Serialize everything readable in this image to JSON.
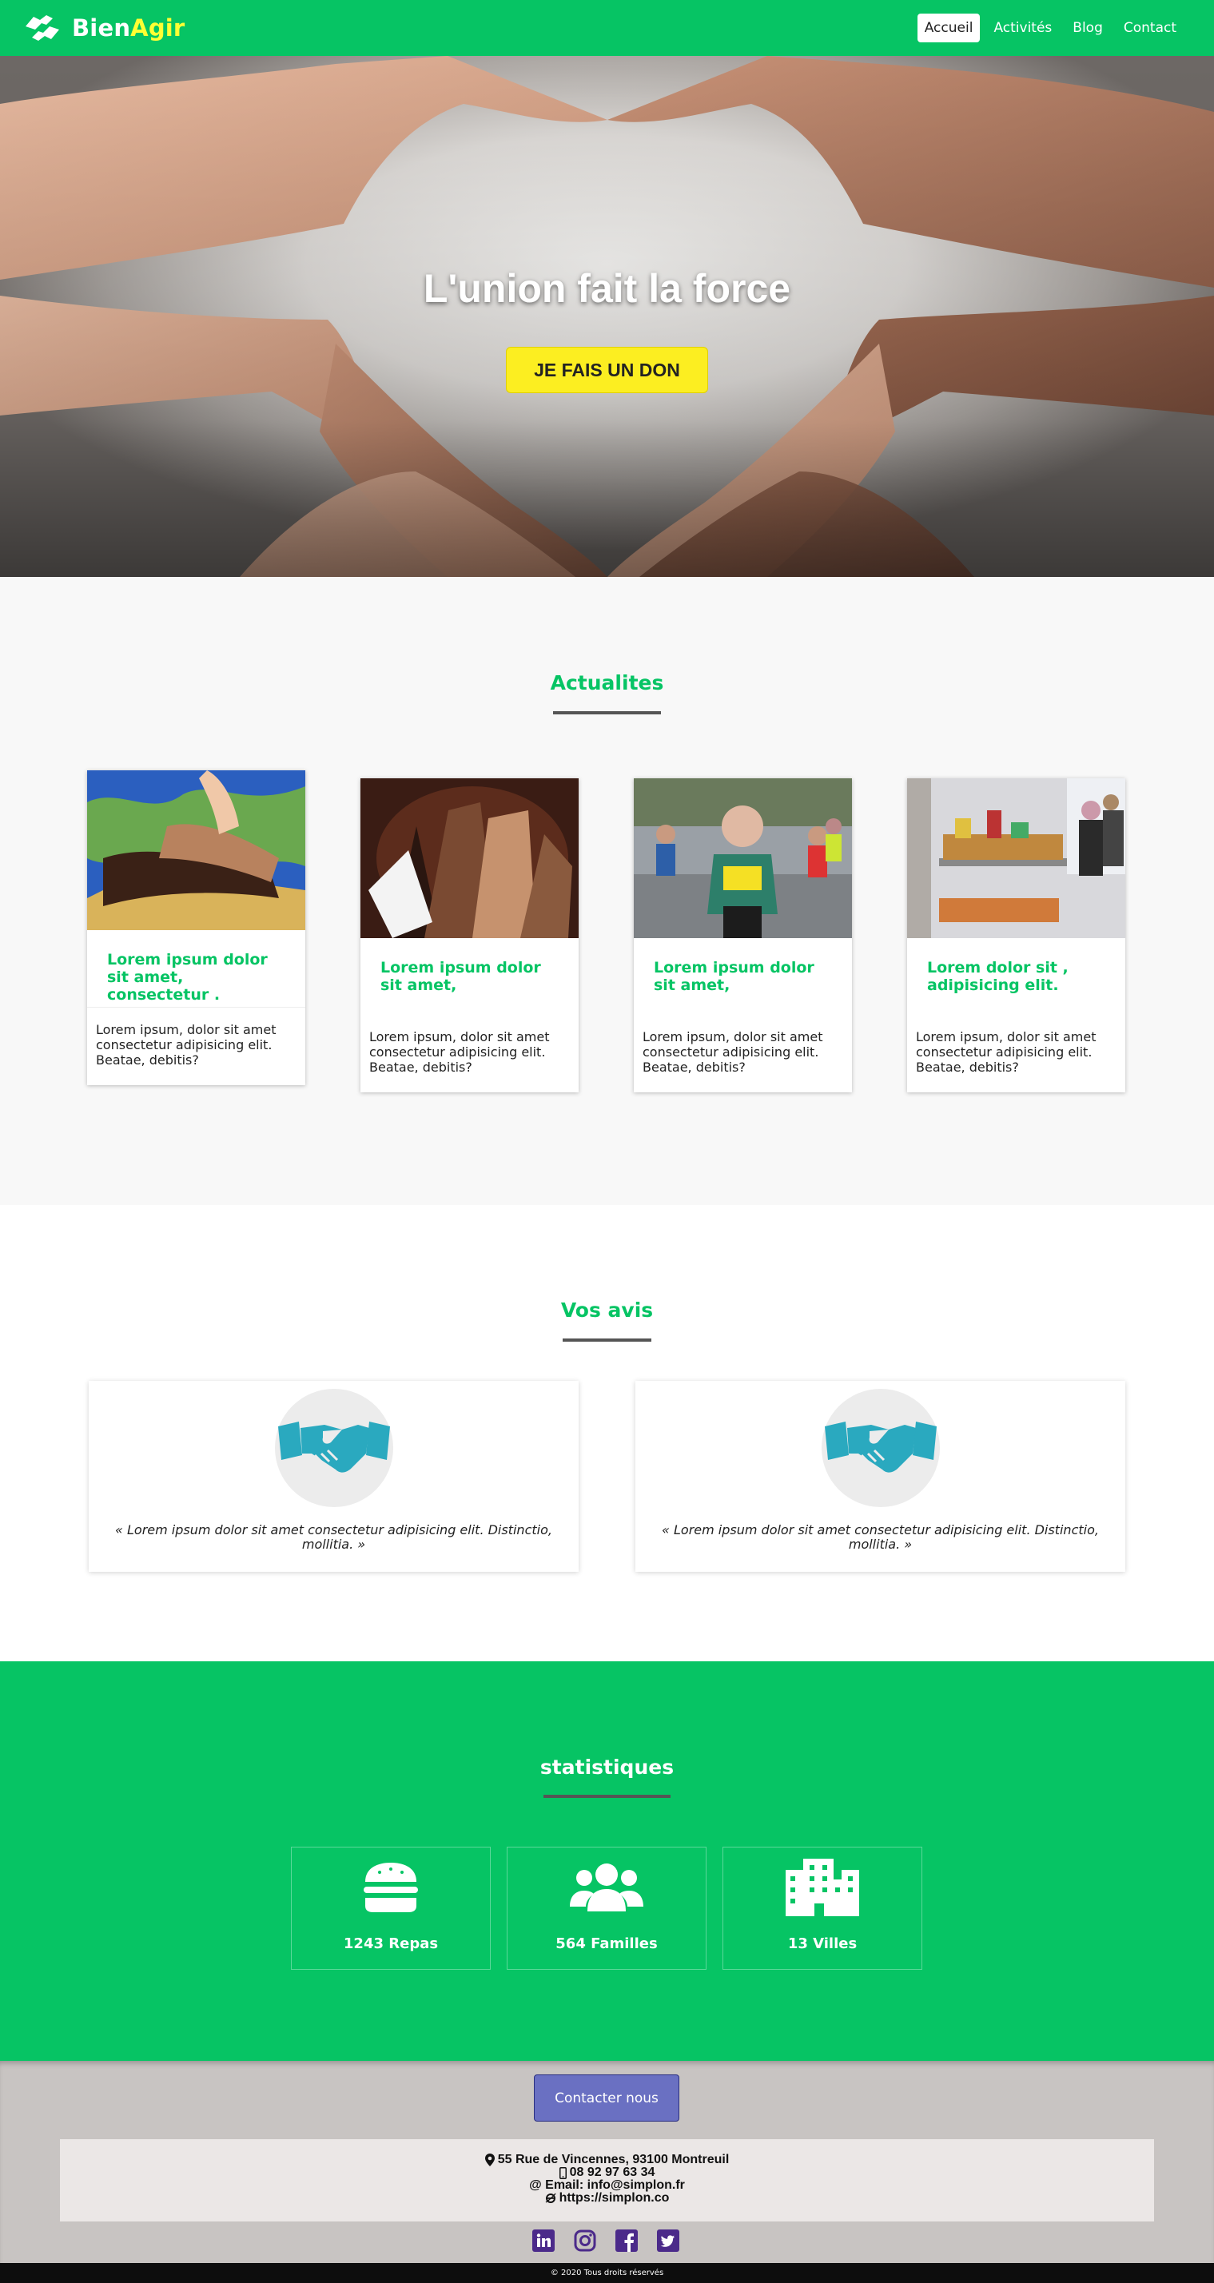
{
  "nav": {
    "brand_part1": "Bien",
    "brand_part2": "Agir",
    "items": [
      "Accueil",
      "Activités",
      "Blog",
      "Contact"
    ],
    "active": "Accueil"
  },
  "hero": {
    "title": "L'union fait la force",
    "button": "JE FAIS UN DON"
  },
  "news": {
    "title": "Actualites",
    "cards": [
      {
        "title": "Lorem ipsum dolor sit amet, consectetur .",
        "text": "Lorem ipsum, dolor sit amet consectetur adipisicing elit. Beatae, debitis?"
      },
      {
        "title": "Lorem ipsum dolor sit amet,",
        "text": "Lorem ipsum, dolor sit amet consectetur adipisicing elit. Beatae, debitis?"
      },
      {
        "title": "Lorem ipsum dolor sit amet,",
        "text": "Lorem ipsum, dolor sit amet consectetur adipisicing elit. Beatae, debitis?"
      },
      {
        "title": "Lorem dolor sit , adipisicing elit.",
        "text": "Lorem ipsum, dolor sit amet consectetur adipisicing elit. Beatae, debitis?"
      }
    ]
  },
  "reviews": {
    "title": "Vos avis",
    "items": [
      {
        "quote": "« Lorem ipsum dolor sit amet consectetur adipisicing elit. Distinctio, mollitia. »"
      },
      {
        "quote": "« Lorem ipsum dolor sit amet consectetur adipisicing elit. Distinctio, mollitia. »"
      }
    ]
  },
  "stats": {
    "title": "statistiques",
    "items": [
      {
        "icon": "burger-icon",
        "label": "1243 Repas"
      },
      {
        "icon": "users-icon",
        "label": "564 Familles"
      },
      {
        "icon": "city-icon",
        "label": "13 Villes"
      }
    ]
  },
  "footer": {
    "contact_button": "Contacter nous",
    "address": "55 Rue de Vincennes, 93100 Montreuil",
    "phone": "08 92 97 63 34",
    "email": "@ Email: info@simplon.fr",
    "website": "https://simplon.co",
    "socials": [
      "linkedin-icon",
      "instagram-icon",
      "facebook-icon",
      "twitter-icon"
    ],
    "copyright": "© 2020 Tous droits réservés"
  },
  "colors": {
    "green": "#06c464",
    "yellow": "#fcee21",
    "brand_accent": "#ffff33",
    "teal_icon": "#2aa9bf",
    "purple": "#4b2a8a",
    "button_blue": "#6a70c2"
  }
}
